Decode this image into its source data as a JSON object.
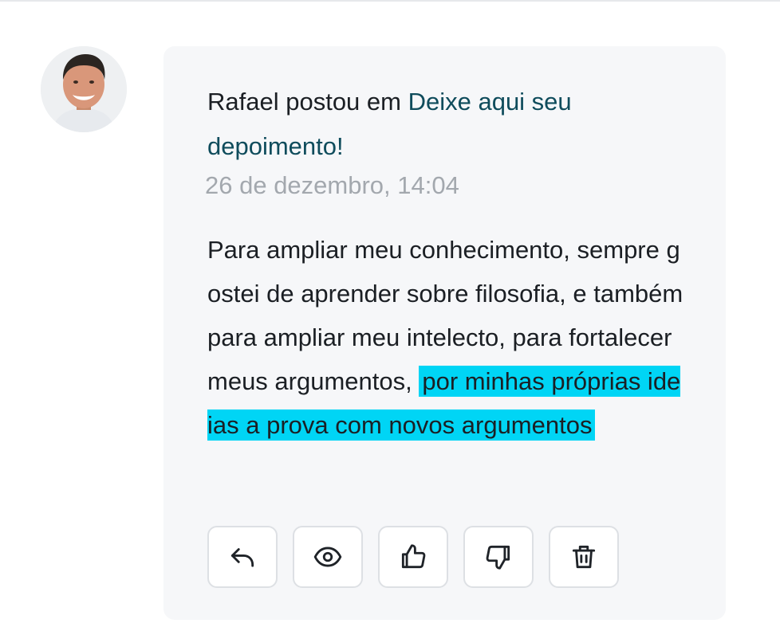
{
  "post": {
    "author": "Rafael",
    "action_text": " postou em ",
    "topic": "Deixe aqui seu depoimento!",
    "timestamp": "26 de dezembro, 14:04",
    "body_plain": "Para ampliar meu conhecimento, sempre gostei de aprender sobre filosofia, e também para ampliar meu intelecto, para fortalecer meus argumentos, ",
    "body_highlighted": "por minhas próprias ideias a prova com novos argumentos ",
    "highlight_color": "#00d5f5"
  },
  "actions": [
    {
      "name": "reply-icon"
    },
    {
      "name": "eye-icon"
    },
    {
      "name": "thumbs-up-icon"
    },
    {
      "name": "thumbs-down-icon"
    },
    {
      "name": "trash-icon"
    }
  ]
}
